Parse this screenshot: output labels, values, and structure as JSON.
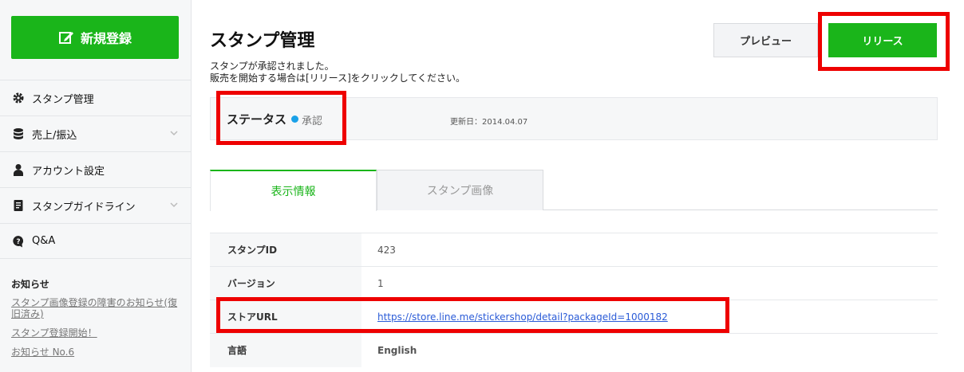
{
  "sidebar": {
    "new_button": "新規登録",
    "items": [
      {
        "label": "スタンプ管理",
        "icon": "gear-icon",
        "chevron": false
      },
      {
        "label": "売上/振込",
        "icon": "database-icon",
        "chevron": true
      },
      {
        "label": "アカウント設定",
        "icon": "user-icon",
        "chevron": false
      },
      {
        "label": "スタンプガイドライン",
        "icon": "document-icon",
        "chevron": true
      },
      {
        "label": "Q&A",
        "icon": "question-bubble-icon",
        "chevron": false
      }
    ],
    "news": {
      "title": "お知らせ",
      "links": [
        "スタンプ画像登録の障害のお知らせ(復旧済み)",
        "スタンプ登録開始！",
        "お知らせ No.6"
      ]
    }
  },
  "main": {
    "title": "スタンプ管理",
    "message_line1": "スタンプが承認されました。",
    "message_line2": "販売を開始する場合は[リリース]をクリックしてください。",
    "preview_button": "プレビュー",
    "release_button": "リリース",
    "status": {
      "label": "ステータス",
      "value": "承認",
      "dot_color": "#1aa1e8",
      "updated": "更新日：2014.04.07"
    },
    "tabs": [
      "表示情報",
      "スタンプ画像"
    ],
    "rows": [
      {
        "key": "スタンプID",
        "value": "423"
      },
      {
        "key": "バージョン",
        "value": "1"
      },
      {
        "key": "ストアURL",
        "value": "https://store.line.me/stickershop/detail?packageId=1000182"
      },
      {
        "key": "言語",
        "value": "English"
      }
    ]
  },
  "colors": {
    "accent": "#1ab51a",
    "highlight": "#ee0000",
    "link": "#2a5bd7"
  }
}
